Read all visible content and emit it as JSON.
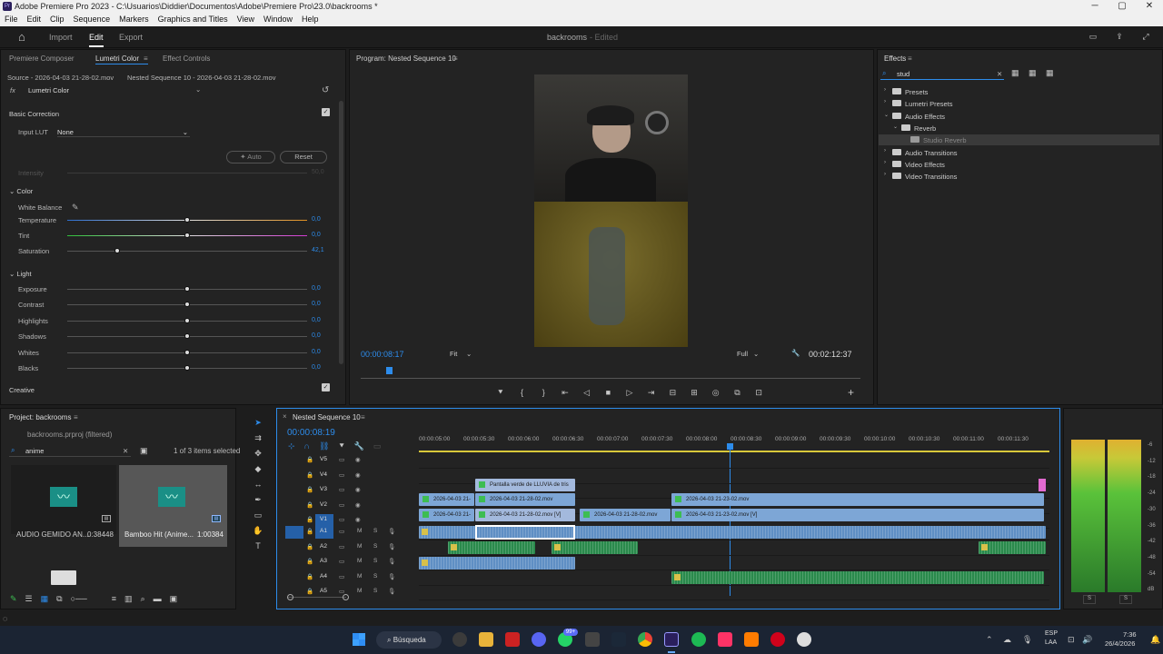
{
  "window": {
    "title": "Adobe Premiere Pro 2023 - C:\\Usuarios\\Diddier\\Documentos\\Adobe\\Premiere Pro\\23.0\\backrooms *",
    "app_badge": "Pr",
    "min": "─",
    "max": "▢",
    "close": "✕"
  },
  "menu": [
    "File",
    "Edit",
    "Clip",
    "Sequence",
    "Markers",
    "Graphics and Titles",
    "View",
    "Window",
    "Help"
  ],
  "header": {
    "home": "⌂",
    "import": "Import",
    "edit": "Edit",
    "export": "Export",
    "project_name": "backrooms",
    "status": "- Edited"
  },
  "left_tabs": {
    "t1": "Premiere Composer",
    "t2": "Lumetri Color",
    "t3": "Effect Controls",
    "menu": "≡"
  },
  "lumetri": {
    "source": "Source - 2026-04-03 21-28-02.mov",
    "target": "Nested Sequence 10 - 2026-04-03 21-28-02.mov",
    "fx": "fx",
    "effect": "Lumetri Color",
    "reset_icon": "↺",
    "basic": "Basic Correction",
    "input_lut_label": "Input LUT",
    "input_lut": "None",
    "auto": "Auto",
    "reset": "Reset",
    "intensity": "Intensity",
    "intensity_val": "50,0",
    "color": "Color",
    "white_balance": "White Balance",
    "rows": [
      {
        "label": "Temperature",
        "value": "0,0",
        "pos": 0.5
      },
      {
        "label": "Tint",
        "value": "0,0",
        "pos": 0.5
      },
      {
        "label": "Saturation",
        "value": "42,1",
        "pos": 0.21
      }
    ],
    "light": "Light",
    "light_rows": [
      {
        "label": "Exposure",
        "value": "0,0",
        "pos": 0.5
      },
      {
        "label": "Contrast",
        "value": "0,0",
        "pos": 0.5
      },
      {
        "label": "Highlights",
        "value": "0,0",
        "pos": 0.5
      },
      {
        "label": "Shadows",
        "value": "0,0",
        "pos": 0.5
      },
      {
        "label": "Whites",
        "value": "0,0",
        "pos": 0.5
      },
      {
        "label": "Blacks",
        "value": "0,0",
        "pos": 0.5
      }
    ],
    "creative": "Creative"
  },
  "program": {
    "title": "Program: Nested Sequence 10",
    "menu": "≡",
    "timecode": "00:00:08:17",
    "fit": "Fit",
    "quality": "Full",
    "duration": "00:02:12:37",
    "wrench": "🔧"
  },
  "transport": [
    "⯆",
    "{",
    "}",
    "⇤",
    "◁",
    "■",
    "▷",
    "⇥",
    "⊟",
    "⊞",
    "◎",
    "⧉",
    "⊡"
  ],
  "effects": {
    "title": "Effects",
    "menu": "≡",
    "search": "stud",
    "tree": [
      {
        "label": "Presets",
        "level": 0
      },
      {
        "label": "Lumetri Presets",
        "level": 0
      },
      {
        "label": "Audio Effects",
        "level": 0
      },
      {
        "label": "Reverb",
        "level": 1
      },
      {
        "label": "Studio Reverb",
        "level": 2
      },
      {
        "label": "Audio Transitions",
        "level": 0
      },
      {
        "label": "Video Effects",
        "level": 0
      },
      {
        "label": "Video Transitions",
        "level": 0
      }
    ]
  },
  "project": {
    "title": "Project: backrooms",
    "menu": "≡",
    "file": "backrooms.prproj (filtered)",
    "search": "anime",
    "count": "1 of 3 items selected",
    "items": [
      {
        "name": "AUDIO GEMIDO AN...",
        "dur": "0:38448"
      },
      {
        "name": "Bamboo Hit (Anime...",
        "dur": "1:00384"
      }
    ]
  },
  "timeline": {
    "tab": "Nested Sequence 10",
    "menu": "≡",
    "timecode": "00:00:08:19",
    "ruler": [
      "00:00:05:00",
      "00:00:05:30",
      "00:00:06:00",
      "00:00:06:30",
      "00:00:07:00",
      "00:00:07:30",
      "00:00:08:00",
      "00:00:08:30",
      "00:00:09:00",
      "00:00:09:30",
      "00:00:10:00",
      "00:00:10:30",
      "00:00:11:00",
      "00:00:11:30"
    ],
    "vtracks": [
      "V5",
      "V4",
      "V3",
      "V2",
      "V1"
    ],
    "atracks": [
      "A1",
      "A2",
      "A3",
      "A4",
      "A5"
    ],
    "m": "M",
    "s": "S",
    "clips": {
      "v3": "Pantalla verde de LLUVIA de tris",
      "v2a": "2026-04-03 21-",
      "v2b": "2026-04-03 21-28-02.mov",
      "v2c": "2026-04-03 21-23-02.mov",
      "v1a": "2026-04-03 21-",
      "v1b": "2026-04-03 21-28-02.mov [V]",
      "v1c": "2026-04-03 21-28-02.mov",
      "v1d": "2026-04-03 21-23-02.mov [V]"
    }
  },
  "meter": {
    "labels": [
      "-6",
      "-12",
      "-18",
      "-24",
      "-30",
      "-36",
      "-42",
      "-48",
      "-54",
      "dB"
    ],
    "s1": "S",
    "s2": "S"
  },
  "taskbar": {
    "search": "Búsqueda",
    "lang": "ESP",
    "lang2": "LAA",
    "time": "7:36",
    "date": "26/4/2026",
    "badge": "99+"
  }
}
